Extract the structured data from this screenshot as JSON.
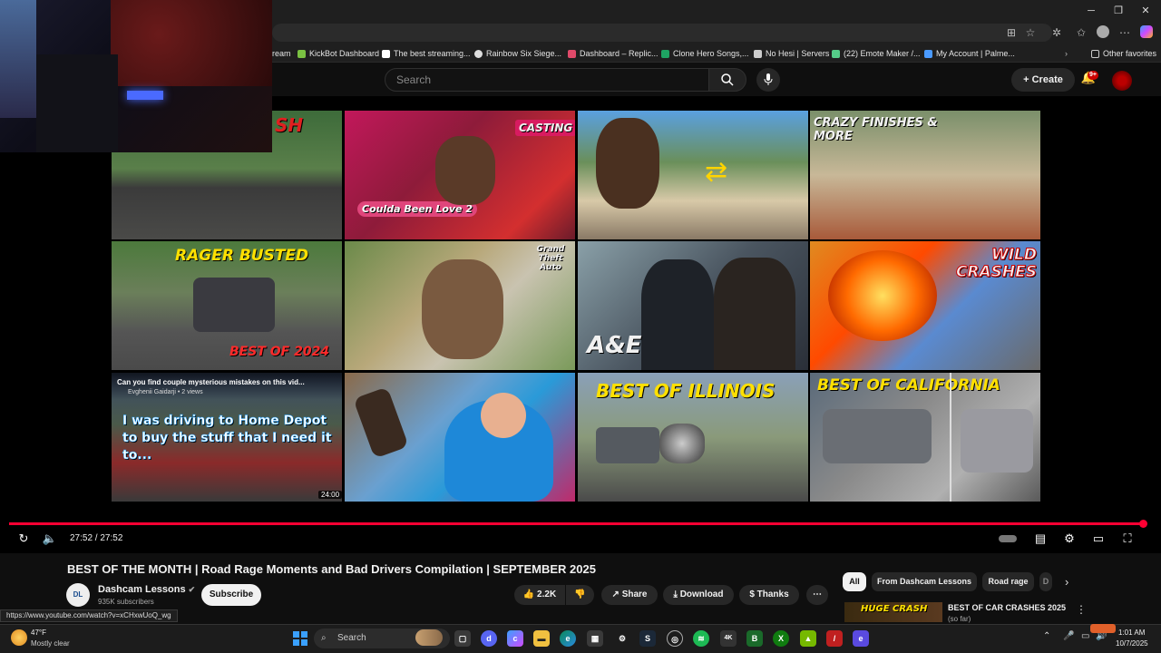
{
  "browser": {
    "window_controls": [
      "─",
      "❐",
      "✕"
    ],
    "bookmarks": [
      {
        "label": "ream",
        "color": "#888888"
      },
      {
        "label": "KickBot Dashboard",
        "color": "#7ac142"
      },
      {
        "label": "The best streaming...",
        "color": "#ffffff"
      },
      {
        "label": "Rainbow Six Siege...",
        "color": "#dddddd"
      },
      {
        "label": "Dashboard – Replic...",
        "color": "#e04a6a"
      },
      {
        "label": "Clone Hero Songs,...",
        "color": "#1ea362"
      },
      {
        "label": "No Hesi | Servers",
        "color": "#cccccc"
      },
      {
        "label": "(22) Emote Maker /...",
        "color": "#55cc88"
      },
      {
        "label": "My Account | Palme...",
        "color": "#4a9aff"
      }
    ],
    "other_favorites": "Other favorites",
    "status_url": "https://www.youtube.com/watch?v=xCHxwUoQ_wg"
  },
  "youtube": {
    "search_placeholder": "Search",
    "create_label": "Create",
    "notif_badge": "9+"
  },
  "endscreen": {
    "thumbs": [
      {
        "label": "SH",
        "color": "#e02020",
        "bg": "linear-gradient(180deg,#3d6b3a 0%,#5a7f4a 45%,#3b3b3b 60%,#4a4a48 100%)"
      },
      {
        "label": "CASTING",
        "label2": "Coulda Been Love 2",
        "color": "#ffffff",
        "bg": "linear-gradient(135deg,#c2185b 0%,#8e1b3a 40%,#d32f2f 80%,#6a1b2a 100%)"
      },
      {
        "label": "",
        "color": "#ffd400",
        "bg": "linear-gradient(180deg,#5aa0e0 0%,#6a8f5a 40%,#d8c9a8 70%,#8a7a66 100%)"
      },
      {
        "label": "CRAZY FINISHES & MORE",
        "color": "#ffffff",
        "bg": "linear-gradient(180deg,#7a8f6a 0%,#c8b898 50%,#a85a3a 100%)"
      },
      {
        "label": "RAGER BUSTED",
        "label2": "BEST OF 2024",
        "color": "#ffe000",
        "bg": "linear-gradient(180deg,#4c7a3c 0%,#6b7f5a 40%,#555 70%,#4a4a4a 100%)"
      },
      {
        "label": "Grand Theft Auto",
        "color": "#ffffff",
        "bg": "linear-gradient(135deg,#6b8a4a 0%,#b8a87a 40%,#c9c3b0 60%,#7a9a5a 100%)"
      },
      {
        "label": "A&E",
        "color": "#ffffff",
        "bg": "linear-gradient(135deg,#8aa0a8 0%,#4a5560 50%,#2a2f38 100%)"
      },
      {
        "label": "WILD CRASHES",
        "color": "#ffffff",
        "bg": "linear-gradient(135deg,#e08a20 0%,#ff4a00 35%,#5a8ad0 60%,#6a6a6a 100%)"
      },
      {
        "label": "Can you find couple mysterious mistakes on this vid...",
        "label2": "I was driving to Home Depot to buy the stuff that I need it to...",
        "meta": "Evghenii Gaidarji • 2 views",
        "duration": "24:00",
        "color": "#ffffff",
        "bg": "linear-gradient(180deg,#3a4a6a 0%,#4a5a4a 40%,#8a2a2a 70%,#3a3a3a 100%)"
      },
      {
        "label": "",
        "color": "#ffffff",
        "bg": "linear-gradient(135deg,#8a6a4a 0%,#6aa0d0 40%,#2a9ad8 60%,#c02a6a 100%)"
      },
      {
        "label": "BEST OF ILLINOIS",
        "color": "#ffe000",
        "bg": "linear-gradient(180deg,#8aa0b8 0%,#8a9a7a 50%,#4a4a4a 100%)"
      },
      {
        "label": "BEST OF CALIFORNIA",
        "color": "#ffe000",
        "bg": "linear-gradient(135deg,#5a6a7a 0%,#8a8a8a 40%,#b0b0b0 70%,#5a5a5a 100%)"
      }
    ]
  },
  "player": {
    "time": "27:52 / 27:52",
    "progress_fraction": 1.0,
    "progress_color": "#ff0033"
  },
  "video": {
    "title": "BEST OF THE MONTH | Road Rage Moments and Bad Drivers Compilation | SEPTEMBER 2025",
    "channel": "Dashcam Lessons",
    "subscribers": "935K subscribers",
    "subscribe_label": "Subscribe",
    "likes": "2.2K",
    "share_label": "Share",
    "download_label": "Download",
    "thanks_label": "Thanks"
  },
  "sidebar": {
    "chips": [
      "All",
      "From Dashcam Lessons",
      "Road rage",
      "D"
    ],
    "rec_thumb_label": "HUGE CRASH",
    "rec_title": "BEST OF CAR CRASHES 2025",
    "rec_sub": "(so far)"
  },
  "taskbar": {
    "temp": "47°F",
    "condition": "Mostly clear",
    "search_label": "Search",
    "time": "1:01 AM",
    "date": "10/7/2025"
  }
}
